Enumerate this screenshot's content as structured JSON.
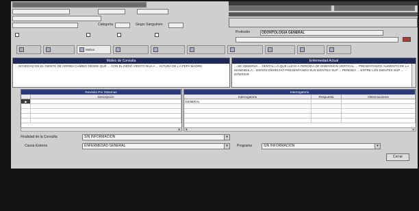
{
  "top": {
    "document_value": "",
    "name_value": "",
    "occupation_value": "",
    "type_value": "",
    "category_label": "Categoría",
    "category_value": "",
    "blood_label": "Grupo Sanguíneo",
    "blood_value": "",
    "right_banner": "",
    "right_value": "",
    "right_header": "",
    "indicator_label": "",
    "option_labels": [
      "",
      "",
      "",
      ""
    ]
  },
  "profile": {
    "label": "Profesión",
    "value": "ODONTOLOGIA GENERAL",
    "sub_value": ""
  },
  "tabs": [
    "",
    "",
    "Motivo",
    "",
    "",
    "",
    "",
    "",
    "",
    ""
  ],
  "motivo": {
    "title": "Motivo de Consulta",
    "text": "... NOVEDAD EN EL DIENTE DE ARRIBA CAMBIO DESDE QUE ... CON EL DEDO VIENTO NUA A ... ALTURA DE LA PEPA MADRE"
  },
  "enfermedad": {
    "title": "Enfermedad Actual",
    "text": "... SE OBSERVA ... DENTAL LO QUE LLEVA A PERDIDA DE DIMENSION VERTICAL ... PRESENTANDO ALIMENTO DE LA MANDIBULA... DIENTE DERECHO PRESENTANDO SUS DIENTES SUP ... PERDIDA ... ENTRE LOS DIENTES SUP ... INTERIOR"
  },
  "revision": {
    "title": "Revisión Por Sistemas",
    "col_1": "",
    "col_2": "Descripción",
    "rows": [
      {
        "marker": "▶",
        "value": ""
      },
      {
        "marker": "",
        "value": ""
      },
      {
        "marker": "",
        "value": ""
      },
      {
        "marker": "",
        "value": ""
      },
      {
        "marker": "",
        "value": ""
      }
    ]
  },
  "interrogatorio": {
    "title": "Interrogatorio",
    "columns": [
      "Interrogatorio",
      "Respuesta",
      "Observaciones"
    ],
    "rows": [
      [
        "GENERAL",
        "",
        ""
      ],
      [
        "",
        "",
        ""
      ],
      [
        "",
        "",
        ""
      ],
      [
        "",
        "",
        ""
      ],
      [
        "",
        "",
        ""
      ]
    ]
  },
  "bottom": {
    "finalidad_label": "Finalidad de la Consulta",
    "finalidad_value": "SIN INFORMACION",
    "causa_label": "Causa Externa",
    "causa_value": "ENFERMEDAD GENERAL",
    "programa_label": "Programa",
    "programa_value": "SIN INFORMACION",
    "close_label": "Cerrar"
  },
  "colors": {
    "panel_header": "#1e2a5a",
    "grid_header": "#2b3a7d",
    "window": "#cfcfcf"
  }
}
